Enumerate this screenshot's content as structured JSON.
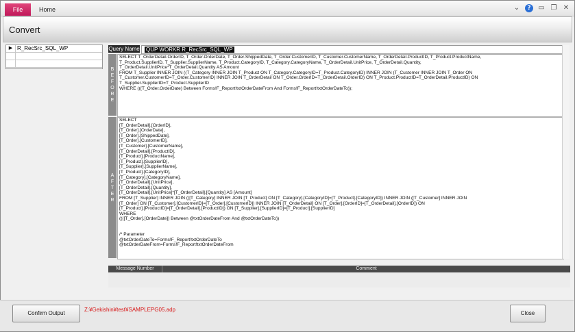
{
  "ribbon": {
    "file_tab": "File",
    "home_tab": "Home"
  },
  "window_icons": [
    "chevron-down-icon",
    "help-icon",
    "minimize-icon",
    "restore-icon",
    "close-icon"
  ],
  "header": {
    "title": "Convert"
  },
  "left_list": {
    "rows": [
      {
        "marker": "▶",
        "name": "R_RecSrc_SQL_WP"
      },
      {
        "marker": "",
        "name": ""
      },
      {
        "marker": "",
        "name": ""
      }
    ]
  },
  "query": {
    "name_label": "Query Name",
    "name_value": "QUP WORKR R_RecSrc_SQL_WP"
  },
  "before": {
    "label": "BEFORE",
    "sql": "SELECT T_OrderDetail.OrderID, T_Order.OrderDate, T_Order.ShippedDate, T_Order.CustomerID, T_Customer.CustomerName, T_OrderDetail.ProductID, T_Product.ProductName,\nT_Product.SupplierID, T_Supplier.SupplierName, T_Product.CategoryID, T_Category.CategoryName, T_OrderDetail.UnitPrice, T_OrderDetail.Quantity,\nT_OrderDetail.UnitPrice*T_OrderDetail.Quantity AS Amount\nFROM T_Supplier INNER JOIN ((T_Category INNER JOIN T_Product ON T_Category.CategoryID=T_Product.CategoryID) INNER JOIN (T_Customer INNER JOIN T_Order ON\nT_Customer.CustomerID=T_Order.CustomerID) INNER JOIN T_OrderDetail ON T_Order.OrderID=T_OrderDetail.OrderID) ON T_Product.ProductID=T_OrderDetail.ProductID) ON\nT_Supplier.SupplierID=T_Product.SupplierID\nWHERE (((T_Order.OrderDate) Between Forms!F_Report!txtOrderDateFrom And Forms!F_Report!txtOrderDateTo));"
  },
  "after": {
    "label": "AFTER",
    "sql": "SELECT\n[T_OrderDetail].[OrderID],\n[T_Order].[OrderDate],\n[T_Order].[ShippedDate],\n[T_Order].[CustomerID],\n[T_Customer].[CustomerName],\n[T_OrderDetail].[ProductID],\n[T_Product].[ProductName],\n[T_Product].[SupplierID],\n[T_Supplier].[SupplierName],\n[T_Product].[CategoryID],\n[T_Category].[CategoryName],\n[T_OrderDetail].[UnitPrice],\n[T_OrderDetail].[Quantity],\n[T_OrderDetail].[UnitPrice]*[T_OrderDetail].[Quantity] AS [Amount]\nFROM [T_Supplier] INNER JOIN (([T_Category] INNER JOIN [T_Product] ON [T_Category].[CategoryID]=[T_Product].[CategoryID]) INNER JOIN ([T_Customer] INNER JOIN\n[T_Order] ON [T_Customer].[CustomerID]=[T_Order].[CustomerID]) INNER JOIN [T_OrderDetail] ON [T_Order].[OrderID]=[T_OrderDetail].[OrderID]) ON\n[T_Product].[ProductID]=[T_OrderDetail].[ProductID]) ON [T_Supplier].[SupplierID]=[T_Product].[SupplierID]\nWHERE\n((([T_Order].[OrderDate]) Between @txtOrderDateFrom And @txtOrderDateTo))\n\n\n/* Parameter\n@txtOrderDateTo=Forms!F_Report!txtOrderDateTo\n@txtOrderDateFrom=Forms!F_Report!txtOrderDateFrom"
  },
  "messages": {
    "col_number": "Message Number",
    "col_comment": "Comment"
  },
  "footer": {
    "confirm_label": "Confirm Output",
    "file_path": "Z:¥Gekishin¥test¥SAMPLEPG05.adp",
    "close_label": "Close",
    "path_color": "#d81818"
  }
}
